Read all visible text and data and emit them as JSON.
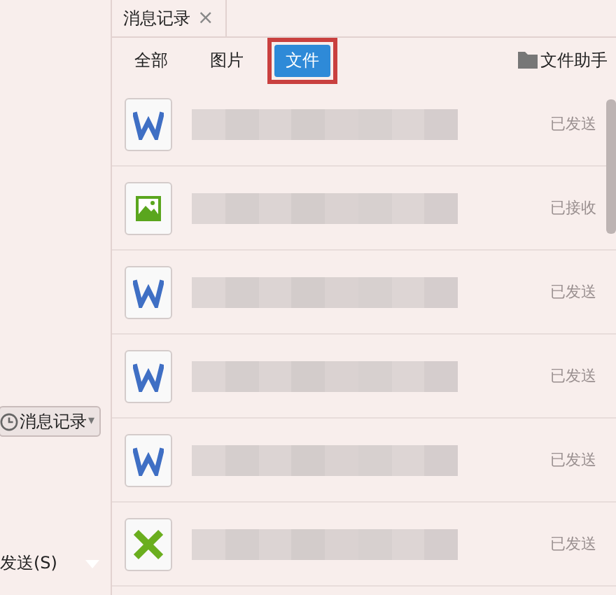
{
  "left_panel": {
    "history_button": {
      "label": "消息记录",
      "caret": "▾"
    },
    "send_button": {
      "label": "发送(S)"
    }
  },
  "tab": {
    "title": "消息记录",
    "close": "×"
  },
  "filters": [
    {
      "label": "全部",
      "selected": false,
      "highlighted": false
    },
    {
      "label": "图片",
      "selected": false,
      "highlighted": false
    },
    {
      "label": "文件",
      "selected": true,
      "highlighted": true
    }
  ],
  "file_assistant": {
    "label": "文件助手"
  },
  "files": [
    {
      "kind": "word",
      "status": "已发送"
    },
    {
      "kind": "image",
      "status": "已接收"
    },
    {
      "kind": "word",
      "status": "已发送"
    },
    {
      "kind": "word",
      "status": "已发送"
    },
    {
      "kind": "word",
      "status": "已发送"
    },
    {
      "kind": "excel",
      "status": "已发送"
    }
  ]
}
